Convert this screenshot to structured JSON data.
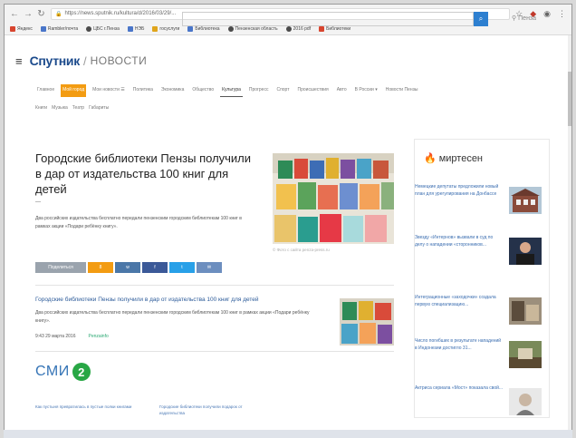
{
  "browser": {
    "url": "https://news.sputnik.ru/kultura/d/2016/03/29/...",
    "bookmarks": [
      "Яндекс",
      "Rambler/почта",
      "ЦБС г.Пенза",
      "НЭБ",
      "госуслуги",
      "Библиотека",
      "Пензенская область",
      "2016 pdf",
      "Библиотеки"
    ]
  },
  "header": {
    "logo": "Спутник",
    "logo_sep": "/",
    "logo_sub": "НОВОСТИ",
    "city": "Пенза"
  },
  "rubrics": [
    {
      "label": "Главное",
      "state": ""
    },
    {
      "label": "Мой город",
      "state": "active"
    },
    {
      "label": "Мои новости ☰",
      "state": ""
    },
    {
      "label": "Политика",
      "state": ""
    },
    {
      "label": "Экономика",
      "state": ""
    },
    {
      "label": "Общество",
      "state": ""
    },
    {
      "label": "Культура",
      "state": "current"
    },
    {
      "label": "Прогресс",
      "state": ""
    },
    {
      "label": "Спорт",
      "state": ""
    },
    {
      "label": "Происшествия",
      "state": ""
    },
    {
      "label": "Авто",
      "state": ""
    },
    {
      "label": "В России ▾",
      "state": ""
    },
    {
      "label": "Новости Пензы",
      "state": ""
    }
  ],
  "tags": [
    "Книги",
    "Музыка",
    "Театр",
    "Габариты"
  ],
  "article": {
    "title": "Городские библиотеки Пензы получили в дар от издательства 100 книг для детей",
    "lead": "Два российских издательства бесплатно передали пензенским городским библиотекам 100 книг в рамках акции «Подари ребёнку книгу».",
    "photo_caption": "© Фото с сайта penza-press.ru",
    "share_label": "Поделиться",
    "share_ok": "8",
    "share_vk": "w",
    "share_fb": "f",
    "share_tw": "t",
    "share_mail": "✉"
  },
  "related": {
    "title": "Городские библиотеки Пензы получили в дар от издательства 100 книг для детей",
    "text": "Два российских издательства бесплатно передали пензенским городским библиотекам 100 книг в рамках акции «Подари ребёнку книгу».",
    "date": "9:43 29 марта 2016",
    "source": "Penzainfo"
  },
  "smi": {
    "text": "СМИ",
    "num": "2",
    "links": [
      "Как пустыня превратилась в пустые полки книгами",
      "Городские библиотеки получили подарок от издательства"
    ]
  },
  "sidebar": {
    "title": "миртесен",
    "items": [
      "Немецкие депутаты предложили новый план для урегулирования на Донбассе",
      "Звезду «Интернов» вызвали в суд по делу о нападении «сторонников...",
      "Интеграционные «заходочки» создала первую специализацию...",
      "Число погибших в результате нападений в Индонезии достигло 31...",
      "Актриса сериала «Мост» показала свой..."
    ]
  }
}
